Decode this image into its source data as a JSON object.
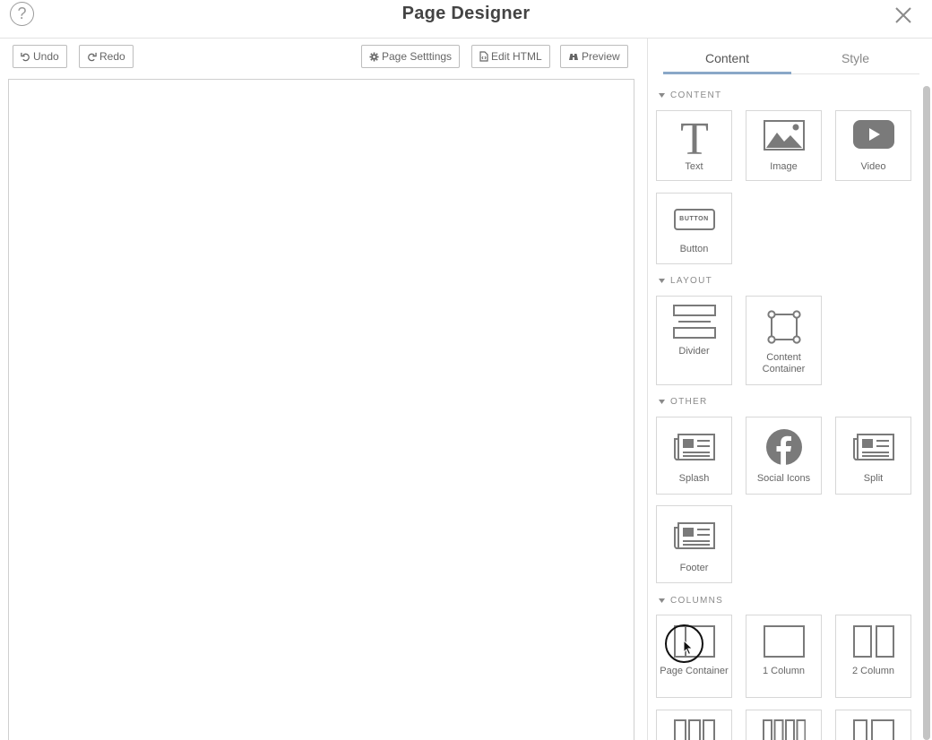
{
  "header": {
    "title": "Page Designer",
    "help_icon": "question-circle-icon",
    "help_glyph": "?",
    "close_icon": "close-x-icon"
  },
  "toolbar": {
    "undo_label": "Undo",
    "redo_label": "Redo",
    "page_settings_label": "Page Setttings",
    "edit_html_label": "Edit HTML",
    "preview_label": "Preview"
  },
  "panel": {
    "tabs": [
      {
        "label": "Content",
        "active": true
      },
      {
        "label": "Style",
        "active": false
      }
    ],
    "sections": {
      "content": "CONTENT",
      "layout": "LAYOUT",
      "other": "OTHER",
      "columns": "COLUMNS"
    },
    "blocks": {
      "text": "Text",
      "image": "Image",
      "video": "Video",
      "button": "Button",
      "button_icon_text": "BUTTON",
      "divider": "Divider",
      "content_container": "Content Container",
      "splash": "Splash",
      "social_icons": "Social Icons",
      "split": "Split",
      "footer": "Footer",
      "page_container": "Page Container",
      "one_column": "1 Column",
      "two_column": "2 Column"
    }
  },
  "colors": {
    "icon_gray": "#7a7a7a",
    "tab_accent": "#8aa8c8",
    "border": "#d7d7d7"
  }
}
